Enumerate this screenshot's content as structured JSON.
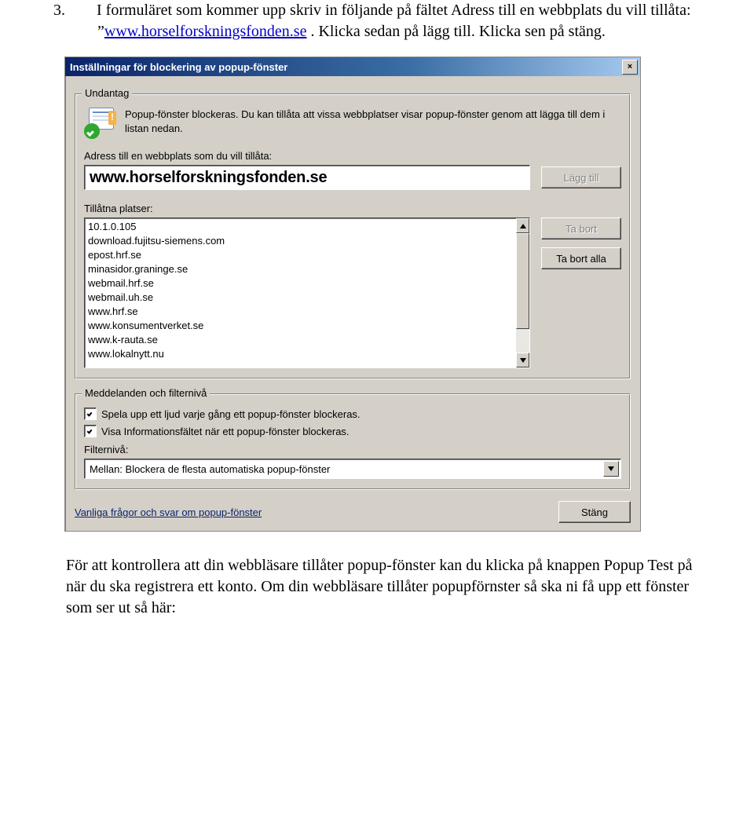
{
  "instruction": {
    "number": "3.",
    "text_a": "I formuläret som kommer upp skriv in följande på fältet Adress till en webbplats du vill tillåta: ”",
    "link_text": "www.horselforskningsfonden.se",
    "text_b": " . Klicka sedan på lägg till. Klicka sen på stäng."
  },
  "dialog": {
    "title": "Inställningar för blockering av popup-fönster",
    "close_glyph": "×",
    "exceptions": {
      "legend": "Undantag",
      "desc": "Popup-fönster blockeras. Du kan tillåta att vissa webbplatser visar popup-fönster genom att lägga till dem i listan nedan.",
      "url_label": "Adress till en webbplats som du vill tillåta:",
      "url_value": "www.horselforskningsfonden.se",
      "add_label": "Lägg till",
      "allowed_label": "Tillåtna platser:",
      "allowed": [
        "10.1.0.105",
        "download.fujitsu-siemens.com",
        "epost.hrf.se",
        "minasidor.graninge.se",
        "webmail.hrf.se",
        "webmail.uh.se",
        "www.hrf.se",
        "www.konsumentverket.se",
        "www.k-rauta.se",
        "www.lokalnytt.nu"
      ],
      "remove_label": "Ta bort",
      "remove_all_label": "Ta bort alla"
    },
    "settings": {
      "legend": "Meddelanden och filternivå",
      "cb1": "Spela upp ett ljud varje gång ett popup-fönster blockeras.",
      "cb2": "Visa Informationsfältet när ett popup-fönster blockeras.",
      "filter_label": "Filternivå:",
      "filter_value": "Mellan: Blockera de flesta automatiska popup-fönster"
    },
    "faq_label": "Vanliga frågor och svar om popup-fönster",
    "close_label": "Stäng"
  },
  "outro": "För att kontrollera att din webbläsare tillåter popup-fönster kan du klicka på knappen Popup Test på när du ska registrera ett konto. Om din webbläsare tillåter popupförnster så ska ni få upp ett fönster som ser ut så här:"
}
